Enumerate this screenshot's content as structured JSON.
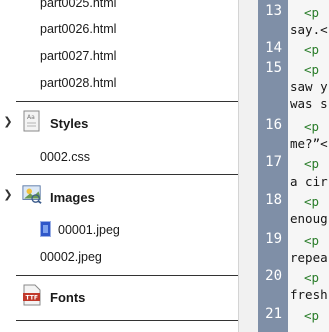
{
  "browser": {
    "text_files": [
      "part0025.html",
      "part0026.html",
      "part0027.html",
      "part0028.html"
    ],
    "styles": {
      "label": "Styles",
      "files": [
        "0002.css"
      ]
    },
    "images": {
      "label": "Images",
      "files": [
        "00001.jpeg",
        "00002.jpeg"
      ]
    },
    "fonts": {
      "label": "Fonts"
    }
  },
  "editor": {
    "line_numbers": [
      "13",
      "14",
      "15",
      "16",
      "17",
      "18",
      "19",
      "20",
      "21"
    ],
    "lines": [
      {
        "num": "13",
        "parts": [
          "<p",
          "say.<"
        ]
      },
      {
        "num": "14",
        "parts": [
          "<p"
        ]
      },
      {
        "num": "15",
        "parts": [
          "<p",
          "saw y",
          "was s"
        ]
      },
      {
        "num": "16",
        "parts": [
          "<p",
          "me?”<"
        ]
      },
      {
        "num": "17",
        "parts": [
          "<p",
          "a cir"
        ]
      },
      {
        "num": "18",
        "parts": [
          "<p",
          "enoug"
        ]
      },
      {
        "num": "19",
        "parts": [
          "<p",
          "repea"
        ]
      },
      {
        "num": "20",
        "parts": [
          "<p",
          "fresh"
        ]
      },
      {
        "num": "21",
        "parts": [
          "<p"
        ]
      }
    ]
  },
  "colors": {
    "gutter": "#7f8fa7",
    "tag": "#2a7d2a",
    "separator": "#333333"
  }
}
